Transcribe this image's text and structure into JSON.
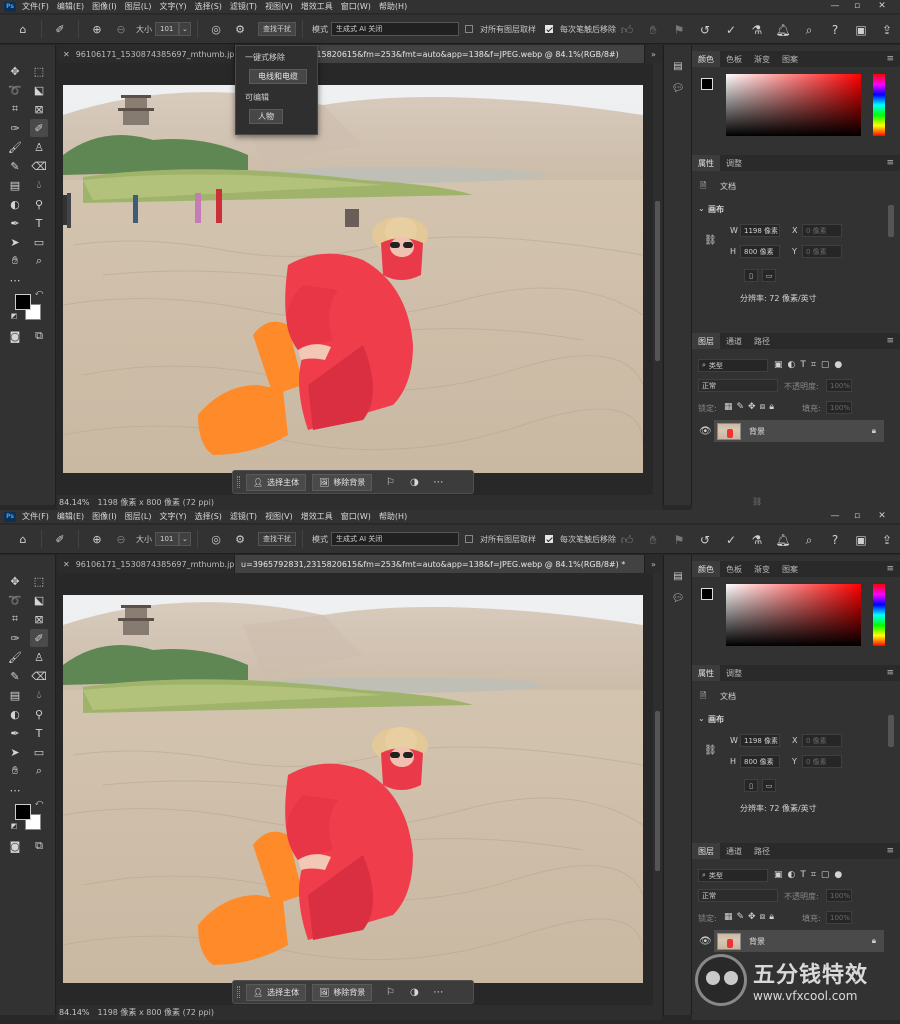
{
  "app": {
    "logo": "Ps"
  },
  "menu": [
    "文件(F)",
    "编辑(E)",
    "图像(I)",
    "图层(L)",
    "文字(Y)",
    "选择(S)",
    "滤镜(T)",
    "视图(V)",
    "增效工具",
    "窗口(W)",
    "帮助(H)"
  ],
  "options": {
    "size_label": "大小",
    "size_value": "101",
    "find_distractions": "查找干扰",
    "mode_label": "模式",
    "mode_value": "生成式 AI 关闭",
    "sample_all_layers": "对所有图层取样",
    "remove_after_stroke": "每次笔触后移除"
  },
  "top": {
    "tabs": [
      "96106171_1530874385697_mthumb.jpg",
      "u=3965792831,2315820615&fm=253&fmt=auto&app=138&f=JPEG.webp @ 84.1%(RGB/8#)"
    ],
    "status_zoom": "84.14%",
    "status_info": "1198 像素 x 800 像素 (72 ppi)"
  },
  "bottom": {
    "tabs": [
      "96106171_1530874385697_mthumb.jpg",
      "u=3965792831,2315820615&fm=253&fmt=auto&app=138&f=JPEG.webp @ 84.1%(RGB/8#) *"
    ],
    "status_zoom": "84.14%",
    "status_info": "1198 像素 x 800 像素 (72 ppi)"
  },
  "dropdown": {
    "one_click_label": "一键式移除",
    "wires_button": "电线和电缆",
    "editable_label": "可编辑",
    "people_button": "人物"
  },
  "contextbar": {
    "select_subject": "选择主体",
    "remove_bg": "移除背景"
  },
  "panels": {
    "color_tabs": [
      "颜色",
      "色板",
      "渐变",
      "图案"
    ],
    "prop_tabs": [
      "属性",
      "调整"
    ],
    "doc_label": "文档",
    "canvas_label": "画布",
    "w_label": "W",
    "w_value": "1198 像素",
    "h_label": "H",
    "h_value": "800 像素",
    "x_label": "X",
    "x_value": "0 像素",
    "y_label": "Y",
    "y_value": "0 像素",
    "resolution": "分辨率: 72 像素/英寸",
    "layer_tabs": [
      "图层",
      "通道",
      "路径"
    ],
    "kind": "类型",
    "blend": "正常",
    "opacity_label": "不透明度:",
    "opacity_value": "100%",
    "lock_label": "锁定:",
    "fill_label": "填充:",
    "fill_value": "100%",
    "layer_name": "背景"
  },
  "watermark": {
    "title": "五分钱特效",
    "url": "www.vfxcool.com"
  }
}
